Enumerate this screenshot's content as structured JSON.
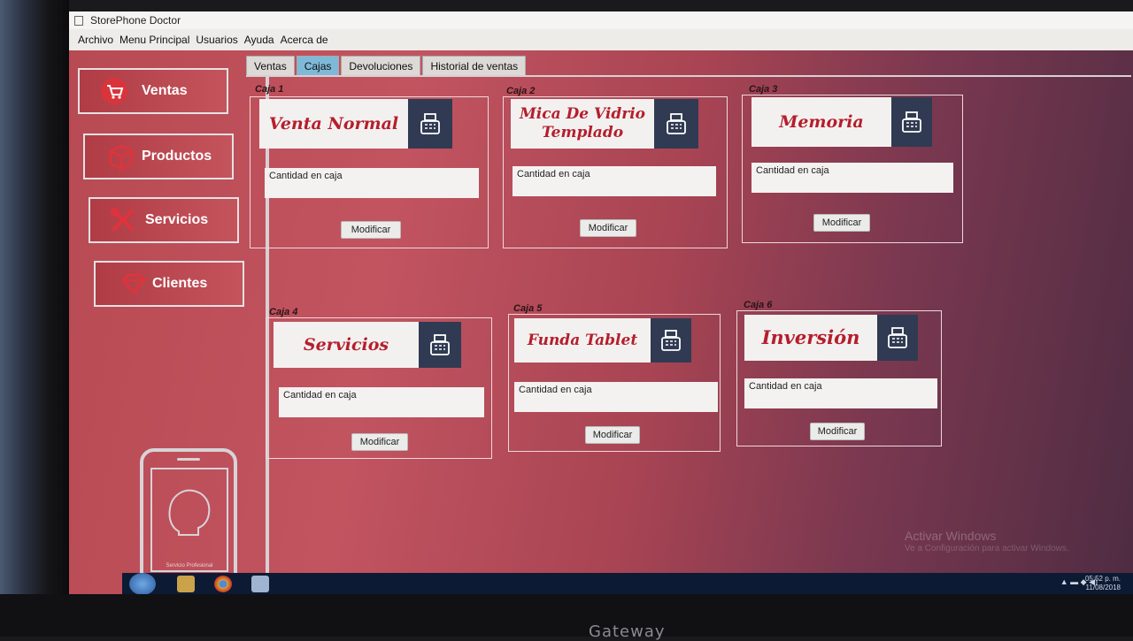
{
  "window": {
    "title": "StorePhone Doctor"
  },
  "menu": [
    "Archivo",
    "Menu Principal",
    "Usuarios",
    "Ayuda",
    "Acerca de"
  ],
  "sidebar": {
    "items": [
      {
        "label": "Ventas",
        "icon": "cart-icon"
      },
      {
        "label": "Productos",
        "icon": "box-icon"
      },
      {
        "label": "Servicios",
        "icon": "tools-icon"
      },
      {
        "label": "Clientes",
        "icon": "diamond-icon"
      }
    ],
    "logo_text": "Servicio Profesional"
  },
  "tabs": [
    {
      "label": "Ventas",
      "active": false
    },
    {
      "label": "Cajas",
      "active": true
    },
    {
      "label": "Devoluciones",
      "active": false
    },
    {
      "label": "Historial de ventas",
      "active": false
    }
  ],
  "cajas": [
    {
      "label": "Caja 1",
      "name": "Venta Normal",
      "field_label": "Cantidad en caja",
      "button": "Modificar"
    },
    {
      "label": "Caja 2",
      "name": "Mica De Vidrio Templado",
      "field_label": "Cantidad en caja",
      "button": "Modificar"
    },
    {
      "label": "Caja 3",
      "name": "Memoria",
      "field_label": "Cantidad en caja",
      "button": "Modificar"
    },
    {
      "label": "Caja 4",
      "name": "Servicios",
      "field_label": "Cantidad en caja",
      "button": "Modificar"
    },
    {
      "label": "Caja 5",
      "name": "Funda Tablet",
      "field_label": "Cantidad en caja",
      "button": "Modificar"
    },
    {
      "label": "Caja 6",
      "name": "Inversión",
      "field_label": "Cantidad en caja",
      "button": "Modificar"
    }
  ],
  "watermark": {
    "line1": "Activar Windows",
    "line2": "Ve a Configuración para activar Windows."
  },
  "taskbar": {
    "time": "05:52 p. m.",
    "date": "11/08/2018"
  },
  "brand": "Gateway",
  "colors": {
    "accent": "#c0434c",
    "tab_active": "#7fb9d8",
    "register_icon_bg": "#303a52"
  }
}
